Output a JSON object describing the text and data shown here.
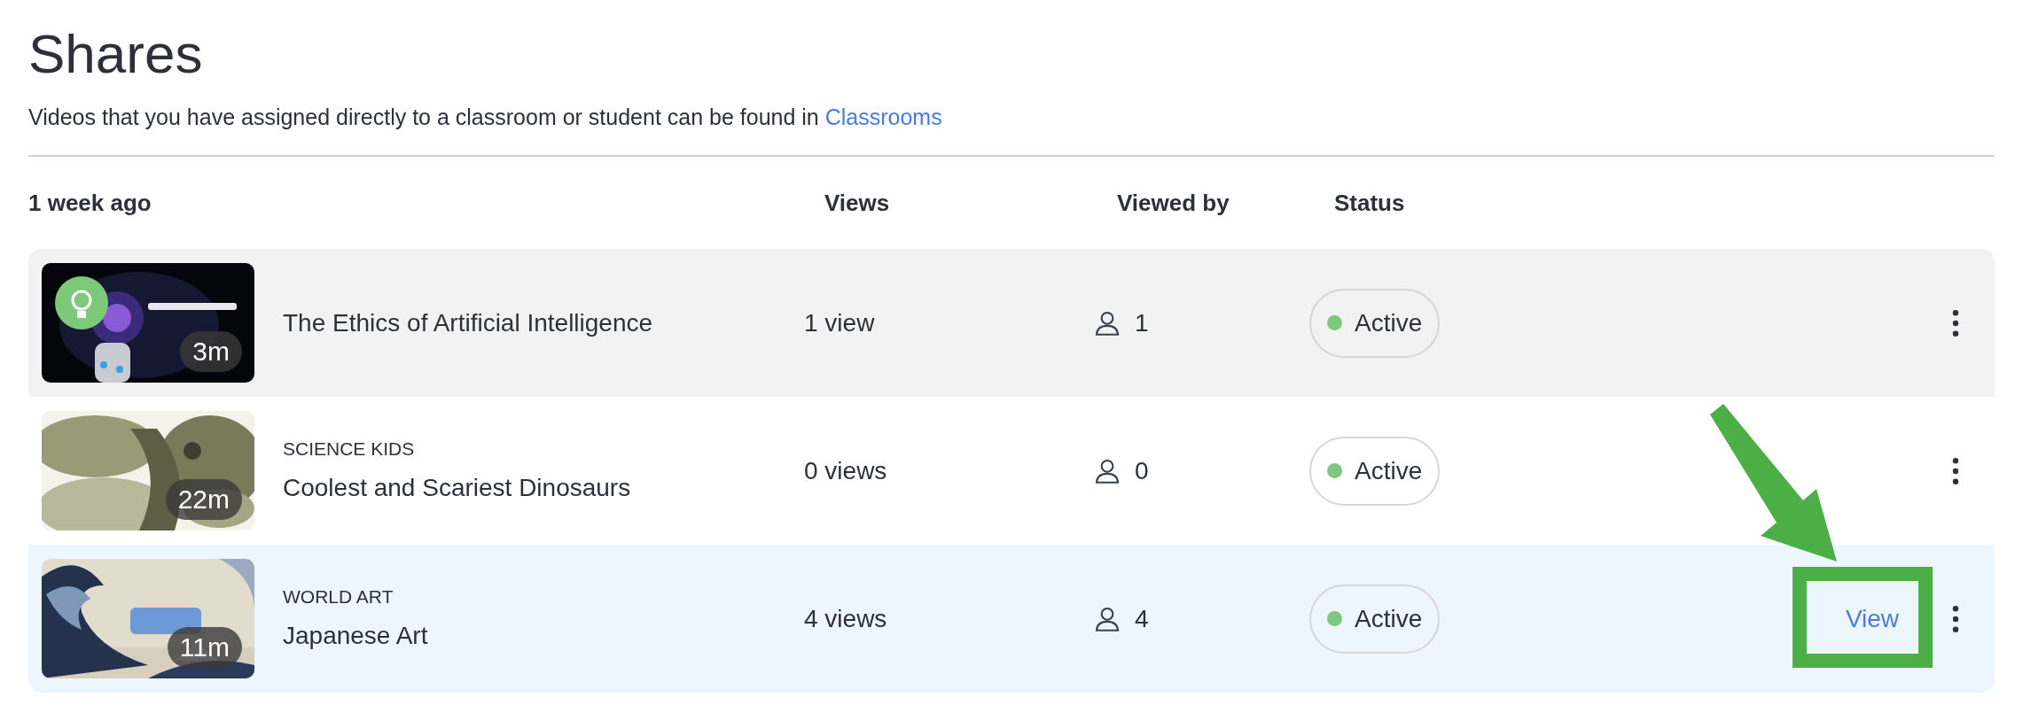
{
  "page": {
    "title": "Shares",
    "subtitle": "Videos that you have assigned directly to a classroom or student can be found in",
    "subtitle_link": "Classrooms"
  },
  "group": {
    "label": "1 week ago",
    "columns": [
      "Views",
      "Viewed by",
      "Status"
    ]
  },
  "rows": [
    {
      "duration": "3m",
      "category": null,
      "title": "The Ethics of Artificial Intelligence",
      "views": "1 view",
      "viewed_by": "1",
      "status": "Active",
      "hovered": true,
      "selected": false,
      "action": null
    },
    {
      "duration": "22m",
      "category": "SCIENCE KIDS",
      "title": "Coolest and Scariest Dinosaurs",
      "views": "0 views",
      "viewed_by": "0",
      "status": "Active",
      "hovered": false,
      "selected": false,
      "action": null
    },
    {
      "duration": "11m",
      "category": "WORLD ART",
      "title": "Japanese Art",
      "views": "4 views",
      "viewed_by": "4",
      "status": "Active",
      "hovered": false,
      "selected": true,
      "action": "View"
    }
  ],
  "annotation": {
    "kind": "arrow_and_frame"
  }
}
